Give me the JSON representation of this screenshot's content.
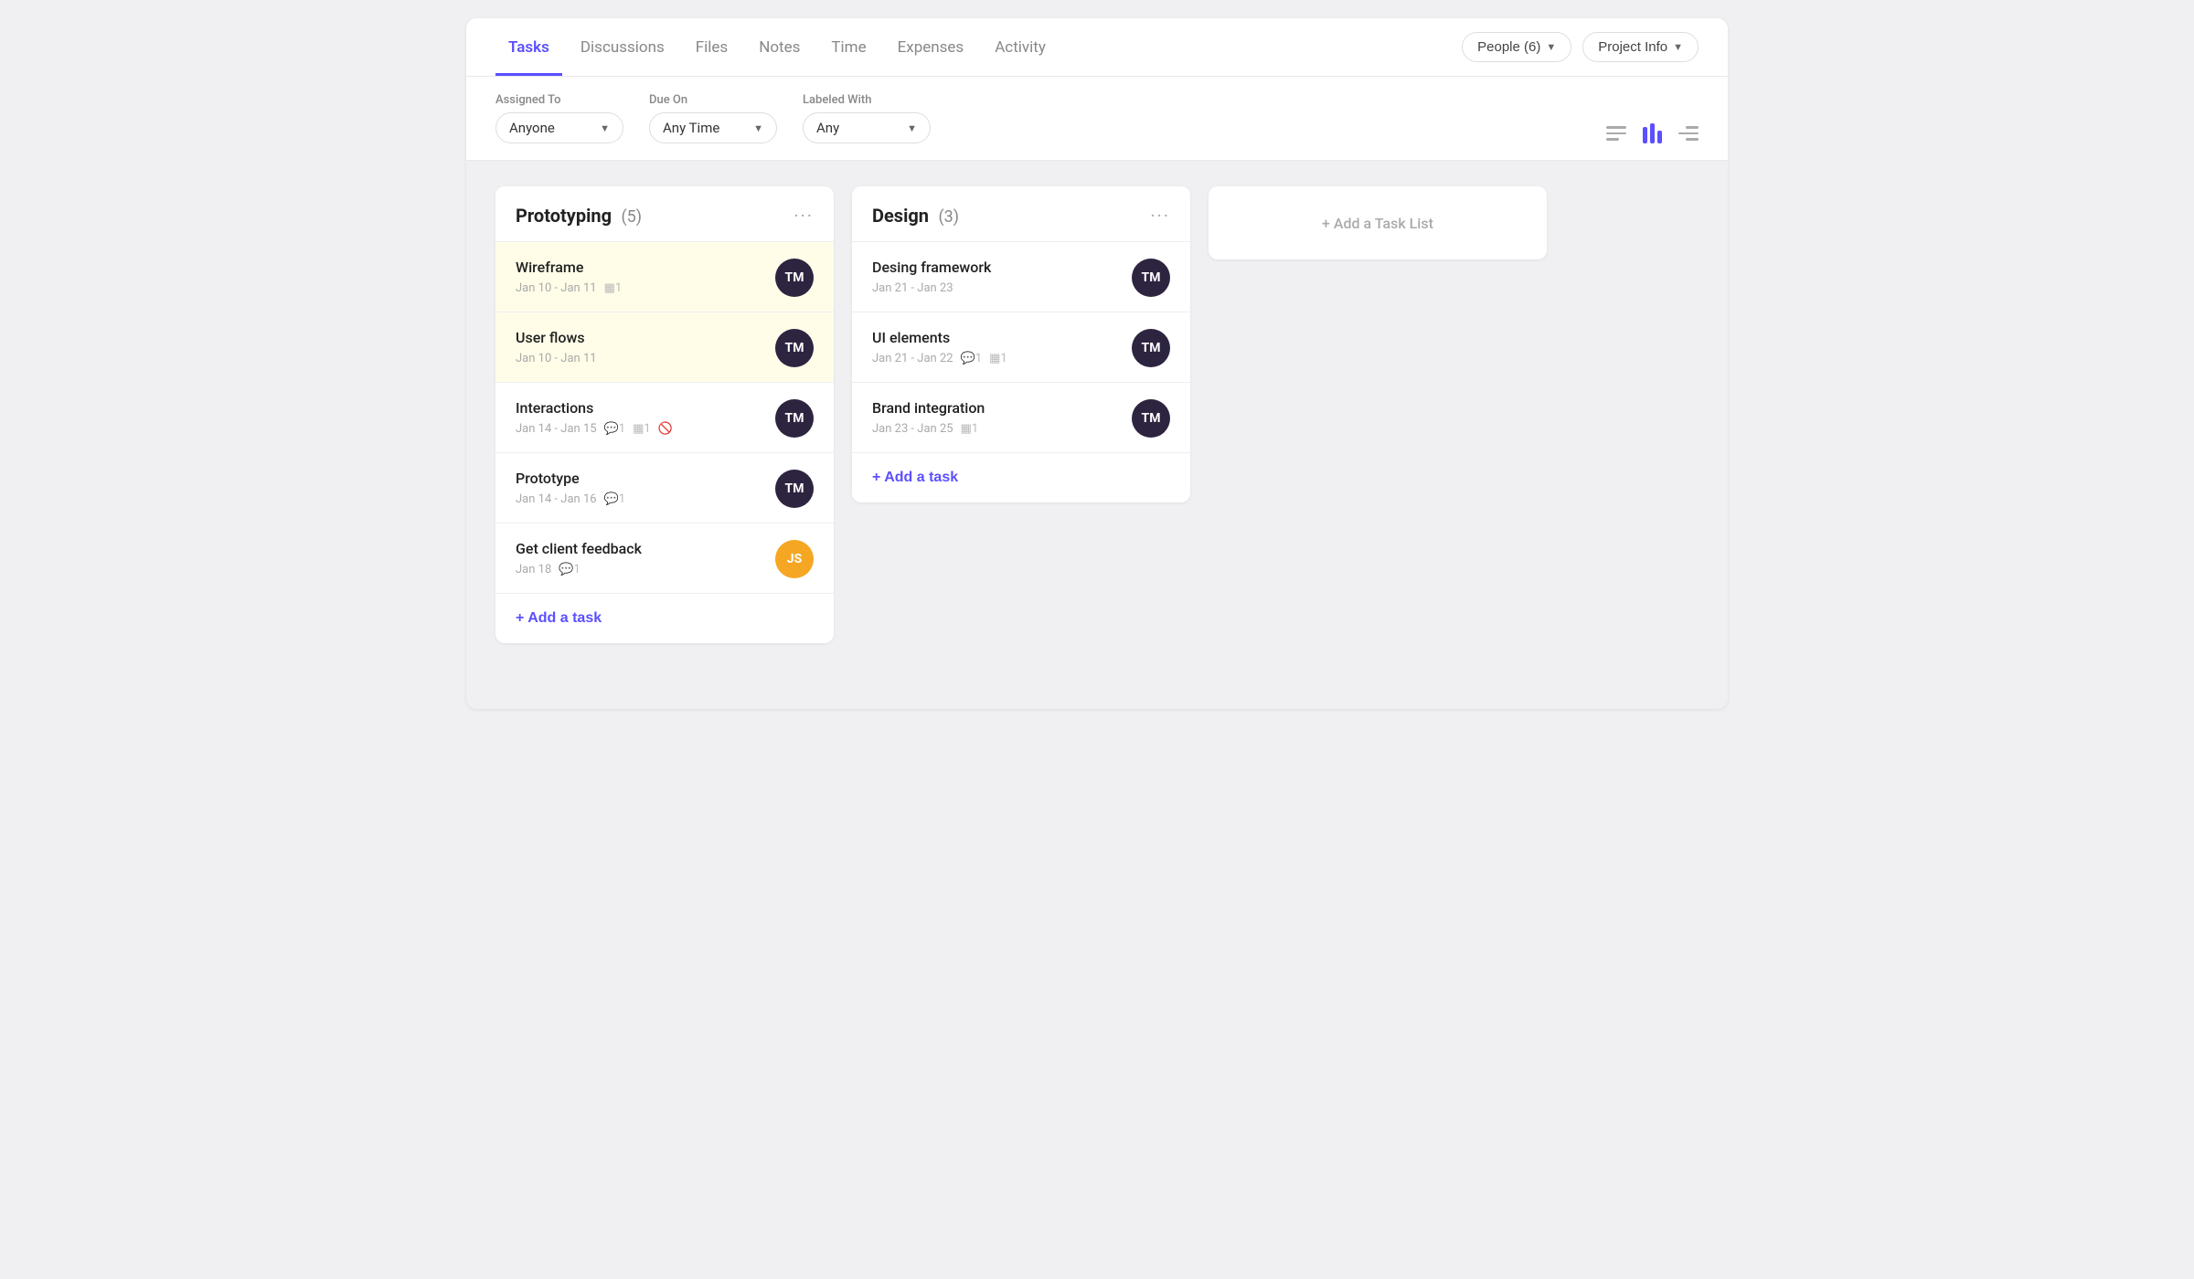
{
  "nav": {
    "tabs": [
      {
        "id": "tasks",
        "label": "Tasks",
        "active": true
      },
      {
        "id": "discussions",
        "label": "Discussions",
        "active": false
      },
      {
        "id": "files",
        "label": "Files",
        "active": false
      },
      {
        "id": "notes",
        "label": "Notes",
        "active": false
      },
      {
        "id": "time",
        "label": "Time",
        "active": false
      },
      {
        "id": "expenses",
        "label": "Expenses",
        "active": false
      },
      {
        "id": "activity",
        "label": "Activity",
        "active": false
      }
    ],
    "people_btn": "People (6)",
    "project_info_btn": "Project Info"
  },
  "filters": {
    "assigned_to_label": "Assigned To",
    "assigned_to_value": "Anyone",
    "due_on_label": "Due On",
    "due_on_value": "Any Time",
    "labeled_with_label": "Labeled With",
    "labeled_with_value": "Any"
  },
  "columns": [
    {
      "id": "prototyping",
      "title": "Prototyping",
      "count": "(5)",
      "tasks": [
        {
          "id": "t1",
          "name": "Wireframe",
          "date": "Jan 10 - Jan 11",
          "meta_icons": [
            "filter-1"
          ],
          "highlighted": true,
          "avatar_initials": "TM",
          "avatar_type": "dark"
        },
        {
          "id": "t2",
          "name": "User flows",
          "date": "Jan 10 - Jan 11",
          "meta_icons": [],
          "highlighted": true,
          "avatar_initials": "TM",
          "avatar_type": "dark"
        },
        {
          "id": "t3",
          "name": "Interactions",
          "date": "Jan 14 - Jan 15",
          "meta_icons": [
            "comment-1",
            "filter-1",
            "hidden"
          ],
          "highlighted": false,
          "avatar_initials": "TM",
          "avatar_type": "dark"
        },
        {
          "id": "t4",
          "name": "Prototype",
          "date": "Jan 14 - Jan 16",
          "meta_icons": [
            "comment-1"
          ],
          "highlighted": false,
          "avatar_initials": "TM",
          "avatar_type": "dark"
        },
        {
          "id": "t5",
          "name": "Get client feedback",
          "date": "Jan 18",
          "meta_icons": [
            "comment-1"
          ],
          "highlighted": false,
          "avatar_initials": "JS",
          "avatar_type": "orange"
        }
      ],
      "add_task_label": "+ Add a task"
    },
    {
      "id": "design",
      "title": "Design",
      "count": "(3)",
      "tasks": [
        {
          "id": "d1",
          "name": "Desing framework",
          "date": "Jan 21 - Jan 23",
          "meta_icons": [],
          "highlighted": false,
          "avatar_initials": "TM",
          "avatar_type": "dark"
        },
        {
          "id": "d2",
          "name": "UI elements",
          "date": "Jan 21 - Jan 22",
          "meta_icons": [
            "comment-1",
            "filter-1"
          ],
          "highlighted": false,
          "avatar_initials": "TM",
          "avatar_type": "dark"
        },
        {
          "id": "d3",
          "name": "Brand integration",
          "date": "Jan 23 - Jan 25",
          "meta_icons": [
            "filter-1"
          ],
          "highlighted": false,
          "avatar_initials": "TM",
          "avatar_type": "dark"
        }
      ],
      "add_task_label": "+ Add a task"
    }
  ],
  "add_list": {
    "label": "+ Add a Task List"
  },
  "colors": {
    "accent": "#5b4fff",
    "dark_avatar": "#2d2440",
    "orange_avatar": "#f5a623"
  }
}
